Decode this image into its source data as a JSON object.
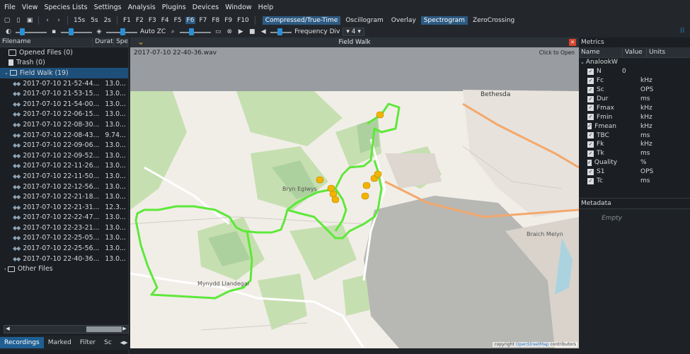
{
  "menu": [
    "File",
    "View",
    "Species Lists",
    "Settings",
    "Analysis",
    "Plugins",
    "Devices",
    "Window",
    "Help"
  ],
  "toolbar1": {
    "times": [
      "15s",
      "5s",
      "2s"
    ],
    "fkeys": [
      "F1",
      "F2",
      "F3",
      "F4",
      "F5",
      "F6",
      "F7",
      "F8",
      "F9",
      "F10"
    ],
    "modes": [
      {
        "label": "Compressed/True-Time",
        "active": true
      },
      {
        "label": "Oscillogram",
        "active": false
      },
      {
        "label": "Overlay",
        "active": false
      },
      {
        "label": "Spectrogram",
        "active": true
      },
      {
        "label": "ZeroCrossing",
        "active": false
      }
    ]
  },
  "toolbar2": {
    "auto_zc": "Auto ZC",
    "freq_label": "Frequency Div",
    "freq_value": "4",
    "slider_levels": [
      0.15,
      0.3,
      0.55,
      0.35
    ]
  },
  "left": {
    "col_filename": "Filename",
    "col_duration": "Durat",
    "col_species": "Spe",
    "opened": "Opened Files (0)",
    "trash": "Trash (0)",
    "folder": "Field Walk (19)",
    "files": [
      {
        "name": "2017-07-10 21-52-44...",
        "dur": "13.0..."
      },
      {
        "name": "2017-07-10 21-53-15...",
        "dur": "13.0..."
      },
      {
        "name": "2017-07-10 21-54-00...",
        "dur": "13.0..."
      },
      {
        "name": "2017-07-10 22-06-15...",
        "dur": "13.0..."
      },
      {
        "name": "2017-07-10 22-08-30...",
        "dur": "13.0..."
      },
      {
        "name": "2017-07-10 22-08-43...",
        "dur": "9.74..."
      },
      {
        "name": "2017-07-10 22-09-06...",
        "dur": "13.0..."
      },
      {
        "name": "2017-07-10 22-09-52...",
        "dur": "13.0..."
      },
      {
        "name": "2017-07-10 22-11-26...",
        "dur": "13.0..."
      },
      {
        "name": "2017-07-10 22-11-50...",
        "dur": "13.0..."
      },
      {
        "name": "2017-07-10 22-12-56...",
        "dur": "13.0..."
      },
      {
        "name": "2017-07-10 22-21-18...",
        "dur": "13.0..."
      },
      {
        "name": "2017-07-10 22-21-31...",
        "dur": "12.3..."
      },
      {
        "name": "2017-07-10 22-22-47...",
        "dur": "13.0..."
      },
      {
        "name": "2017-07-10 22-23-21...",
        "dur": "13.0..."
      },
      {
        "name": "2017-07-10 22-25-05...",
        "dur": "13.0..."
      },
      {
        "name": "2017-07-10 22-25-56...",
        "dur": "13.0..."
      },
      {
        "name": "2017-07-10 22-40-36...",
        "dur": "13.0..."
      }
    ],
    "other": "Other Files",
    "tabs": [
      {
        "label": "Recordings",
        "active": true
      },
      {
        "label": "Marked",
        "active": false
      },
      {
        "label": "Filter",
        "active": false
      },
      {
        "label": "Sc",
        "active": false
      }
    ]
  },
  "center": {
    "title": "Field Walk",
    "filename": "2017-07-10 22-40-36.wav",
    "click_open": "Click to Open",
    "copyright_prefix": "copyright ",
    "copyright_link": "OpenStreetMap",
    "copyright_suffix": " contributors",
    "place_labels": [
      "Bethesda",
      "Bryn Eglwys",
      "Mynydd Llandegai",
      "Braich Melyn"
    ]
  },
  "right": {
    "title": "Metrics",
    "col_name": "Name",
    "col_value": "Value",
    "col_units": "Units",
    "group": "AnalookW",
    "metrics": [
      {
        "name": "N",
        "value": "0",
        "unit": ""
      },
      {
        "name": "Fc",
        "value": "",
        "unit": "kHz"
      },
      {
        "name": "Sc",
        "value": "",
        "unit": "OPS"
      },
      {
        "name": "Dur",
        "value": "",
        "unit": "ms"
      },
      {
        "name": "Fmax",
        "value": "",
        "unit": "kHz"
      },
      {
        "name": "Fmin",
        "value": "",
        "unit": "kHz"
      },
      {
        "name": "Fmean",
        "value": "",
        "unit": "kHz"
      },
      {
        "name": "TBC",
        "value": "",
        "unit": "ms"
      },
      {
        "name": "Fk",
        "value": "",
        "unit": "kHz"
      },
      {
        "name": "Tk",
        "value": "",
        "unit": "ms"
      },
      {
        "name": "Quality",
        "value": "",
        "unit": "%"
      },
      {
        "name": "S1",
        "value": "",
        "unit": "OPS"
      },
      {
        "name": "Tc",
        "value": "",
        "unit": "ms"
      }
    ],
    "metadata_title": "Metadata",
    "metadata_empty": "Empty"
  },
  "colors": {
    "accent": "#2b8fd6",
    "track": "#5ee83a",
    "marker": "#f2b400",
    "selected": "#1d4f7a"
  }
}
